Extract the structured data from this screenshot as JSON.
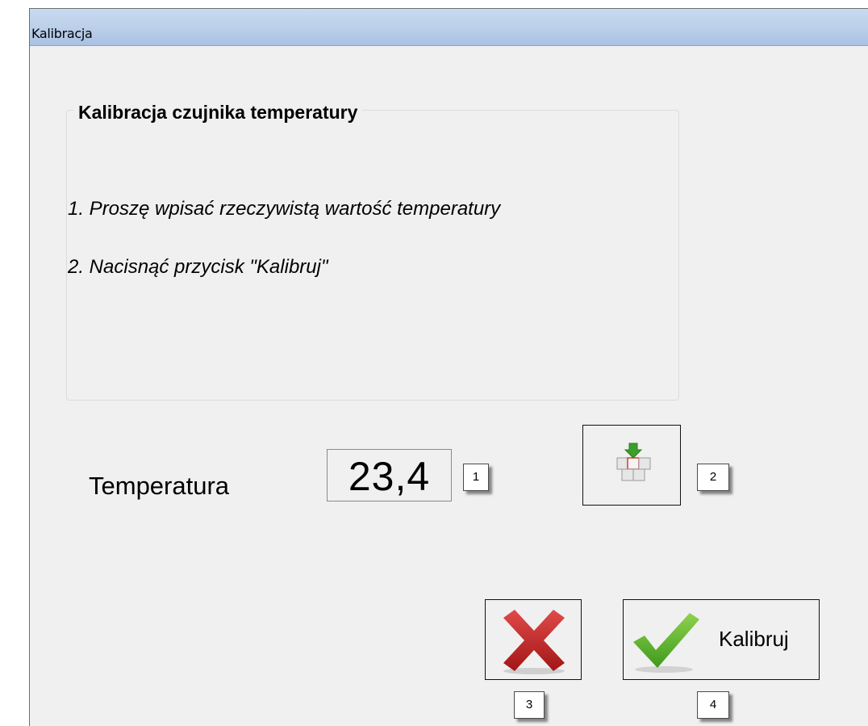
{
  "window": {
    "title": "Kalibracja"
  },
  "group": {
    "title": "Kalibracja czujnika temperatury",
    "step1": "1. Proszę wpisać rzeczywistą wartość temperatury",
    "step2": "2. Nacisnąć przycisk \"Kalibruj\""
  },
  "temperature": {
    "label": "Temperatura",
    "value": "23,4"
  },
  "buttons": {
    "keyboard_icon": "keyboard-icon",
    "cancel_icon": "red-x-icon",
    "calibrate_icon": "green-check-icon",
    "calibrate_label": "Kalibruj"
  },
  "callouts": {
    "c1": "1",
    "c2": "2",
    "c3": "3",
    "c4": "4"
  },
  "colors": {
    "titlebar": "#bcd0ea",
    "background": "#f0f0f0",
    "cancel_red": "#c62828",
    "check_green": "#5fb92d",
    "keyboard_arrow_green": "#3aa02b"
  }
}
